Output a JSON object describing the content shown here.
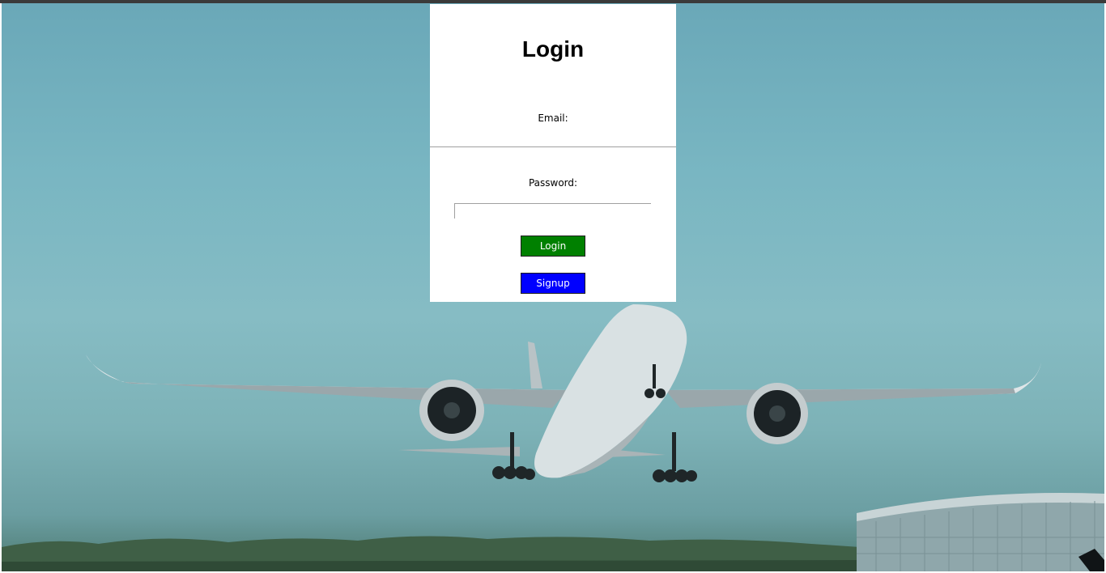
{
  "login_form": {
    "title": "Login",
    "email_label": "Email:",
    "email_value": "",
    "password_label": "Password:",
    "password_value": "",
    "login_button": "Login",
    "signup_button": "Signup"
  },
  "colors": {
    "login_button": "#008000",
    "signup_button": "#0000ff",
    "panel": "#ffffff"
  },
  "background": {
    "image": "airplane-takeoff-photo"
  }
}
